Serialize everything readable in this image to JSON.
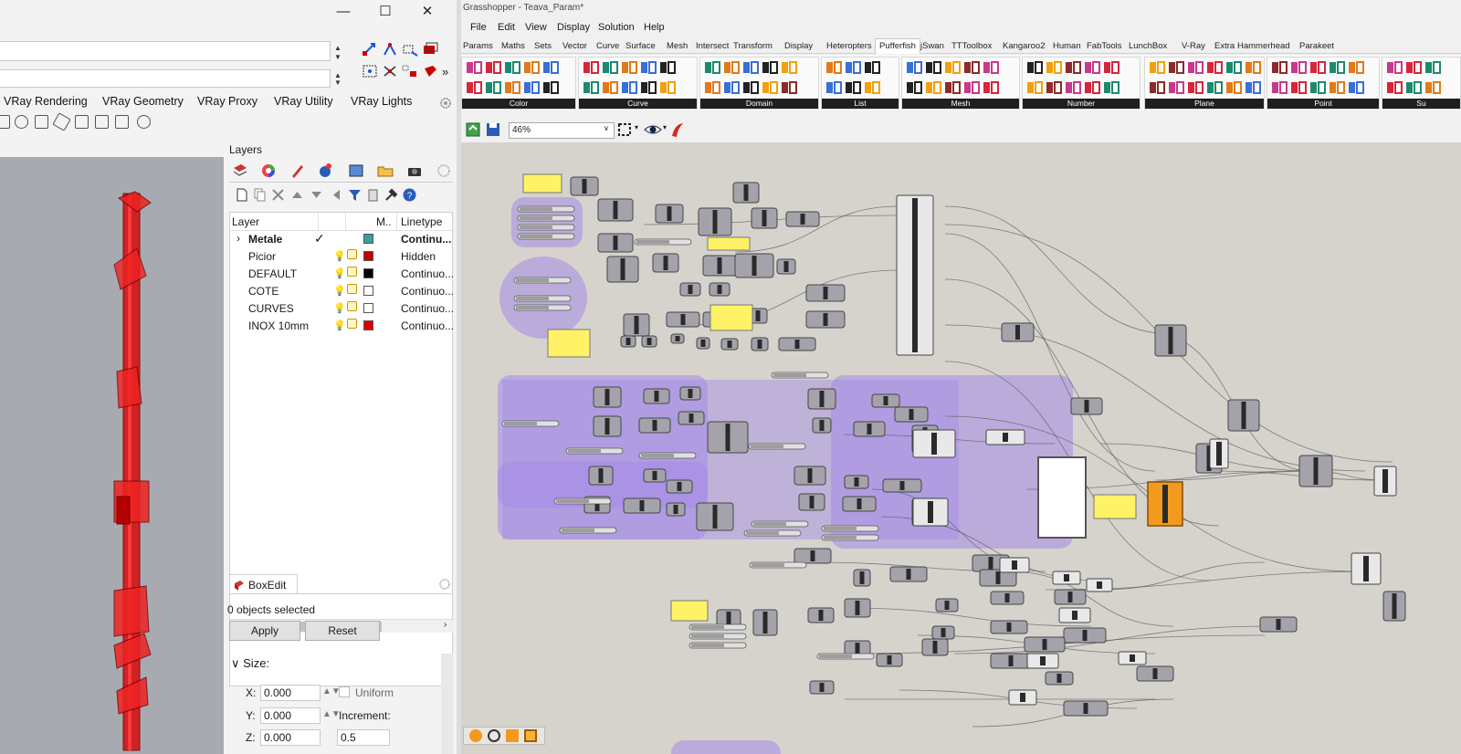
{
  "rhino": {
    "window_controls": [
      "—",
      "☐",
      "✕"
    ],
    "toolbar_tabs": [
      "VRay Rendering",
      "VRay Geometry",
      "VRay Proxy",
      "VRay Utility",
      "VRay Lights"
    ],
    "layers_panel": {
      "title": "Layers",
      "columns": [
        "Layer",
        "M..",
        "Linetype"
      ],
      "rows": [
        {
          "name": "Metale",
          "current": true,
          "color": "#3f9c9c",
          "linetype": "Continu...",
          "bold": true
        },
        {
          "name": "Picior",
          "color": "#c00000",
          "linetype": "Hidden"
        },
        {
          "name": "DEFAULT",
          "color": "#000000",
          "linetype": "Continuo..."
        },
        {
          "name": "COTE",
          "color": "#ffffff",
          "linetype": "Continuo..."
        },
        {
          "name": "CURVES",
          "color": "#ffffff",
          "linetype": "Continuo..."
        },
        {
          "name": "INOX 10mm",
          "color": "#e00000",
          "linetype": "Continuo..."
        }
      ]
    },
    "boxedit": {
      "title": "BoxEdit",
      "status": "0 objects selected",
      "apply": "Apply",
      "reset": "Reset",
      "size_label": "Size:",
      "x_label": "X:",
      "x_value": "0.000",
      "y_label": "Y:",
      "y_value": "0.000",
      "z_label": "Z:",
      "z_value": "0.000",
      "uniform": "Uniform",
      "increment_label": "Increment:",
      "increment_value": "0.5"
    }
  },
  "grasshopper": {
    "title": "Grasshopper - Teava_Param*",
    "menu": [
      "File",
      "Edit",
      "View",
      "Display",
      "Solution",
      "Help"
    ],
    "tabs": [
      "Params",
      "Maths",
      "Sets",
      "Vector",
      "Curve",
      "Surface",
      "Mesh",
      "Intersect",
      "Transform",
      "Display",
      "Heteropters",
      "Pufferfish",
      "jSwan",
      "TTToolbox",
      "Kangaroo2",
      "Human",
      "FabTools",
      "LunchBox",
      "V-Ray",
      "Extra",
      "Hammerhead",
      "Parakeet"
    ],
    "active_tab": "Pufferfish",
    "ribbon_groups": [
      "Color",
      "Curve",
      "Domain",
      "List",
      "Mesh",
      "Number",
      "Plane",
      "Point",
      "Su"
    ],
    "zoom": "46%"
  },
  "colors": {
    "accent_purple": "#a58ae8",
    "panel_yellow": "#fff266",
    "component_grey": "#a4a3ab",
    "orange": "#f39a1e",
    "canvas": "#d6d3cd",
    "geometry_red": "#cc0000"
  }
}
